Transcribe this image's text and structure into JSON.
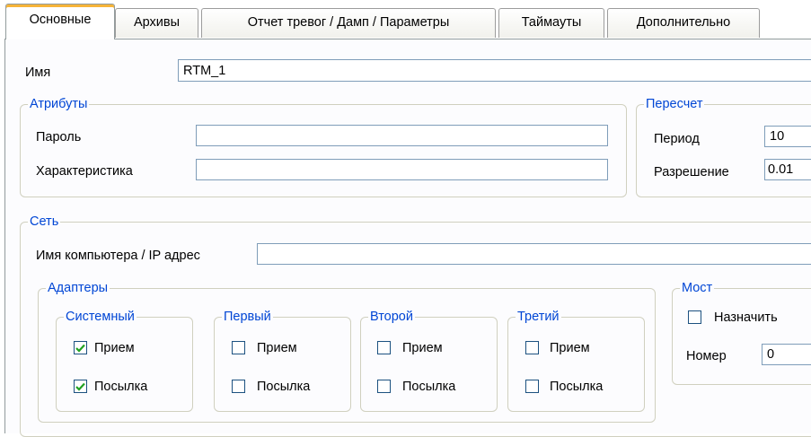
{
  "tabs": [
    {
      "label": "Основные",
      "active": true
    },
    {
      "label": "Архивы",
      "active": false
    },
    {
      "label": "Отчет тревог / Дамп / Параметры",
      "active": false
    },
    {
      "label": "Таймауты",
      "active": false
    },
    {
      "label": "Дополнительно",
      "active": false
    }
  ],
  "name": {
    "label": "Имя",
    "value": "RTM_1"
  },
  "attributes": {
    "title": "Атрибуты",
    "password_label": "Пароль",
    "password_value": "",
    "characteristic_label": "Характеристика",
    "characteristic_value": ""
  },
  "recalc": {
    "title": "Пересчет",
    "period_label": "Период",
    "period_value": "10",
    "resolution_label": "Разрешение",
    "resolution_value": "0.01"
  },
  "network": {
    "title": "Сеть",
    "host_label": "Имя компьютера / IP адрес",
    "host_value": ""
  },
  "adapters": {
    "title": "Адаптеры",
    "groups": [
      {
        "title": "Системный",
        "receive_label": "Прием",
        "receive_checked": true,
        "send_label": "Посылка",
        "send_checked": true
      },
      {
        "title": "Первый",
        "receive_label": "Прием",
        "receive_checked": false,
        "send_label": "Посылка",
        "send_checked": false
      },
      {
        "title": "Второй",
        "receive_label": "Прием",
        "receive_checked": false,
        "send_label": "Посылка",
        "send_checked": false
      },
      {
        "title": "Третий",
        "receive_label": "Прием",
        "receive_checked": false,
        "send_label": "Посылка",
        "send_checked": false
      }
    ]
  },
  "bridge": {
    "title": "Мост",
    "assign_label": "Назначить",
    "assign_checked": false,
    "number_label": "Номер",
    "number_value": "0"
  },
  "colors": {
    "group_title": "#0046d5",
    "check_mark": "#21a121",
    "active_tab_accent": "#f6b439"
  }
}
